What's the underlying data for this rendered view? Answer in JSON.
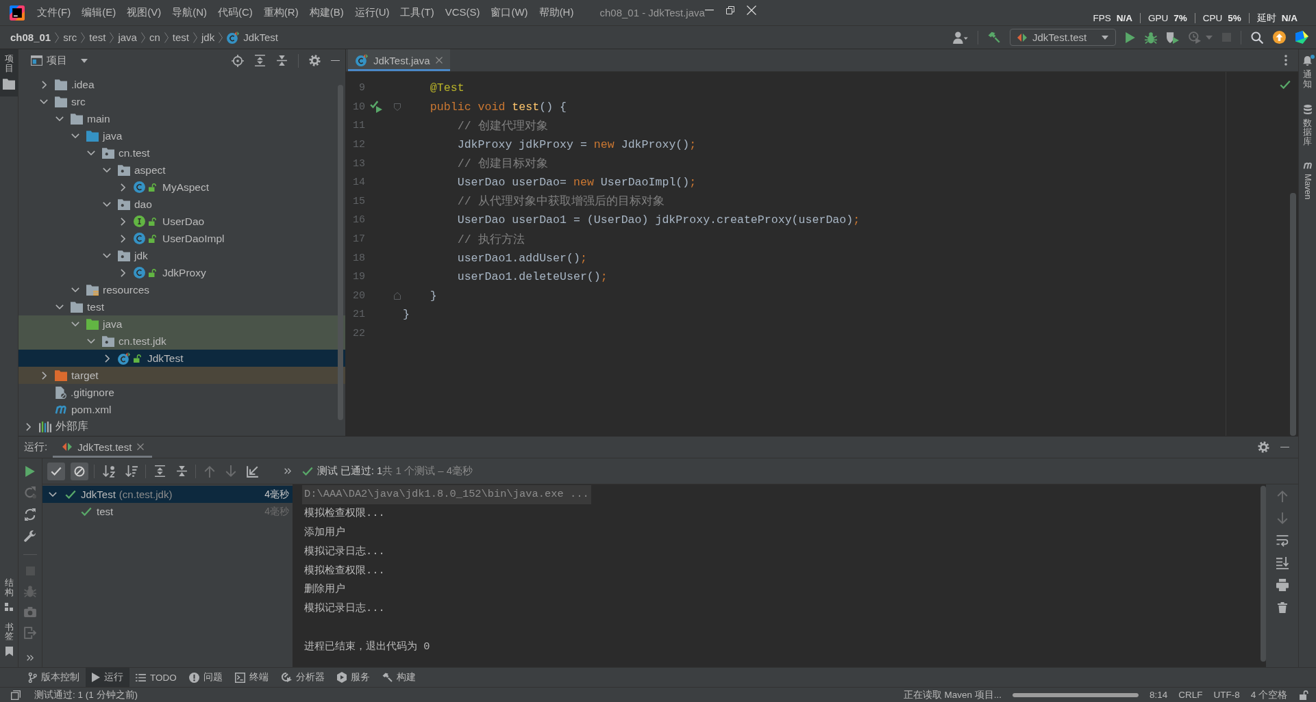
{
  "menu_bar": {
    "items": [
      "文件(F)",
      "编辑(E)",
      "视图(V)",
      "导航(N)",
      "代码(C)",
      "重构(R)",
      "构建(B)",
      "运行(U)",
      "工具(T)",
      "VCS(S)",
      "窗口(W)",
      "帮助(H)"
    ],
    "window_title": "ch08_01 - JdkTest.java"
  },
  "perf_overlay": [
    {
      "label": "FPS",
      "value": "N/A"
    },
    {
      "label": "GPU",
      "value": "7%"
    },
    {
      "label": "CPU",
      "value": "5%"
    },
    {
      "label": "延时",
      "value": "N/A"
    }
  ],
  "breadcrumbs": [
    {
      "label": "ch08_01",
      "kind": "project"
    },
    {
      "label": "src",
      "kind": "folder"
    },
    {
      "label": "test",
      "kind": "folder"
    },
    {
      "label": "java",
      "kind": "folder"
    },
    {
      "label": "cn",
      "kind": "folder"
    },
    {
      "label": "test",
      "kind": "folder"
    },
    {
      "label": "jdk",
      "kind": "folder"
    },
    {
      "label": "JdkTest",
      "kind": "test_class"
    }
  ],
  "main_toolbar": {
    "run_config": "JdkTest.test",
    "buttons": [
      {
        "kind": "run",
        "disabled": false
      },
      {
        "kind": "debug",
        "disabled": false
      },
      {
        "kind": "coverage",
        "disabled": false
      },
      {
        "kind": "profile",
        "disabled": true
      },
      {
        "kind": "stop",
        "disabled": true
      }
    ]
  },
  "left_strip": {
    "top": [
      {
        "label": "项目",
        "kind": "project",
        "selected": true
      }
    ],
    "bottom": [
      {
        "label": "结构",
        "kind": "structure",
        "selected": false
      },
      {
        "label": "书签",
        "kind": "bookmarks",
        "selected": false
      }
    ]
  },
  "right_strip": [
    {
      "label": "通知",
      "kind": "notifications",
      "unread": true
    },
    {
      "label": "数据库",
      "kind": "database",
      "unread": false
    },
    {
      "label": "Maven",
      "kind": "maven",
      "unread": false
    }
  ],
  "project_panel": {
    "title": "项目",
    "tree": [
      {
        "children": [
          {
            "label": ".idea",
            "kind": "folder",
            "expanded": false,
            "selected": false
          },
          {
            "label": "src",
            "kind": "folder",
            "expanded": true,
            "selected": false,
            "children": [
              {
                "label": "main",
                "kind": "folder",
                "expanded": true,
                "selected": false,
                "children": [
                  {
                    "label": "java",
                    "kind": "source_root",
                    "expanded": true,
                    "selected": false,
                    "children": [
                      {
                        "label": "cn.test",
                        "kind": "package",
                        "expanded": true,
                        "selected": false,
                        "children": [
                          {
                            "label": "aspect",
                            "kind": "package",
                            "expanded": true,
                            "selected": false,
                            "children": [
                              {
                                "label": "MyAspect",
                                "kind": "class",
                                "expanded": false,
                                "selected": false
                              }
                            ]
                          },
                          {
                            "label": "dao",
                            "kind": "package",
                            "expanded": true,
                            "selected": false,
                            "children": [
                              {
                                "label": "UserDao",
                                "kind": "interface",
                                "expanded": false,
                                "selected": false
                              },
                              {
                                "label": "UserDaoImpl",
                                "kind": "class",
                                "expanded": false,
                                "selected": false
                              }
                            ]
                          },
                          {
                            "label": "jdk",
                            "kind": "package",
                            "expanded": true,
                            "selected": false,
                            "children": [
                              {
                                "label": "JdkProxy",
                                "kind": "class",
                                "expanded": false,
                                "selected": false
                              }
                            ]
                          }
                        ]
                      }
                    ]
                  },
                  {
                    "label": "resources",
                    "kind": "resources_root",
                    "expanded": true,
                    "selected": false
                  }
                ]
              },
              {
                "label": "test",
                "kind": "folder",
                "expanded": true,
                "selected": false,
                "children": [
                  {
                    "label": "java",
                    "kind": "test_root",
                    "expanded": true,
                    "selected": false,
                    "color": "#4a5449",
                    "children": [
                      {
                        "label": "cn.test.jdk",
                        "kind": "package",
                        "expanded": true,
                        "selected": false,
                        "color": "#4a5449",
                        "children": [
                          {
                            "label": "JdkTest",
                            "kind": "test_class",
                            "expanded": false,
                            "selected": true
                          }
                        ]
                      }
                    ]
                  }
                ]
              }
            ]
          },
          {
            "label": "target",
            "kind": "excluded_folder",
            "expanded": false,
            "selected": false,
            "color": "#4b463a"
          },
          {
            "label": ".gitignore",
            "kind": "ignore_file",
            "selected": false
          },
          {
            "label": "pom.xml",
            "kind": "maven_file",
            "selected": false
          }
        ]
      },
      {
        "label": "外部库",
        "kind": "library",
        "expanded": false,
        "selected": false
      }
    ]
  },
  "editor": {
    "tabs": [
      {
        "label": "JdkTest.java",
        "kind": "test_class",
        "selected": true
      }
    ],
    "lines": [
      {
        "number": "9",
        "tokens": [
          {
            "text": "    @Test",
            "kind": "annotation"
          }
        ]
      },
      {
        "number": "10",
        "gutter_marks": [
          {
            "kind": "run_test"
          },
          {
            "kind": "fold_start"
          }
        ],
        "tokens": [
          {
            "text": "    public void ",
            "kind": "keyword"
          },
          {
            "text": "test",
            "kind": "method"
          },
          {
            "text": "() {",
            "kind": "plain"
          }
        ]
      },
      {
        "number": "11",
        "tokens": [
          {
            "text": "        // 创建代理对象",
            "kind": "comment"
          }
        ]
      },
      {
        "number": "12",
        "tokens": [
          {
            "text": "        JdkProxy jdkProxy = ",
            "kind": "plain"
          },
          {
            "text": "new",
            "kind": "keyword"
          },
          {
            "text": " JdkProxy()",
            "kind": "plain"
          },
          {
            "text": ";",
            "kind": "keyword"
          }
        ]
      },
      {
        "number": "13",
        "tokens": [
          {
            "text": "        // 创建目标对象",
            "kind": "comment"
          }
        ]
      },
      {
        "number": "14",
        "tokens": [
          {
            "text": "        UserDao userDao= ",
            "kind": "plain"
          },
          {
            "text": "new",
            "kind": "keyword"
          },
          {
            "text": " UserDaoImpl()",
            "kind": "plain"
          },
          {
            "text": ";",
            "kind": "keyword"
          }
        ]
      },
      {
        "number": "15",
        "tokens": [
          {
            "text": "        // 从代理对象中获取增强后的目标对象",
            "kind": "comment"
          }
        ]
      },
      {
        "number": "16",
        "tokens": [
          {
            "text": "        UserDao userDao1 = (UserDao) jdkProxy.createProxy(userDao)",
            "kind": "plain"
          },
          {
            "text": ";",
            "kind": "keyword"
          }
        ]
      },
      {
        "number": "17",
        "tokens": [
          {
            "text": "        // 执行方法",
            "kind": "comment"
          }
        ]
      },
      {
        "number": "18",
        "tokens": [
          {
            "text": "        userDao1.addUser()",
            "kind": "plain"
          },
          {
            "text": ";",
            "kind": "keyword"
          }
        ]
      },
      {
        "number": "19",
        "tokens": [
          {
            "text": "        userDao1.deleteUser()",
            "kind": "plain"
          },
          {
            "text": ";",
            "kind": "keyword"
          }
        ]
      },
      {
        "number": "20",
        "gutter_marks": [
          {
            "kind": "fold_end"
          }
        ],
        "tokens": [
          {
            "text": "    }",
            "kind": "plain"
          }
        ]
      },
      {
        "number": "21",
        "tokens": [
          {
            "text": "}",
            "kind": "plain"
          }
        ]
      },
      {
        "number": "22"
      }
    ]
  },
  "run_panel": {
    "label": "运行:",
    "tabs": [
      {
        "label": "JdkTest.test",
        "kind": "test_run",
        "selected": true
      }
    ],
    "side_toolbar": [
      [
        {
          "kind": "rerun",
          "disabled": false
        },
        {
          "kind": "rerun_failed",
          "disabled": true
        },
        {
          "kind": "auto_test",
          "disabled": false
        },
        {
          "kind": "settings",
          "disabled": false
        }
      ],
      [
        {
          "kind": "stop",
          "disabled": true
        },
        {
          "kind": "debug",
          "disabled": true
        },
        {
          "kind": "screenshot",
          "disabled": true
        },
        {
          "kind": "exit",
          "disabled": true
        },
        {
          "kind": "more",
          "disabled": false
        }
      ]
    ],
    "test_toolbar": [
      [
        {
          "kind": "show_passed",
          "on": true
        },
        {
          "kind": "show_ignored",
          "on": true
        }
      ],
      [
        {
          "kind": "sort_alpha",
          "disabled": false
        },
        {
          "kind": "sort_duration",
          "disabled": false
        }
      ],
      [
        {
          "kind": "expand_all",
          "disabled": false
        },
        {
          "kind": "collapse_all",
          "disabled": false
        }
      ],
      [
        {
          "kind": "previous",
          "disabled": true
        },
        {
          "kind": "next",
          "disabled": true
        },
        {
          "kind": "export",
          "disabled": false
        },
        {
          "kind": "more",
          "disabled": false
        }
      ]
    ],
    "summary": {
      "passed": true,
      "status": "测试 已通过: 1",
      "detail": "共 1 个测试 – 4毫秒"
    },
    "test_tree": [
      {
        "label": "JdkTest",
        "package": "(cn.test.jdk)",
        "duration": "4毫秒",
        "passed": true,
        "expanded": true,
        "selected": true,
        "children": [
          {
            "label": "test",
            "duration": "4毫秒",
            "passed": true,
            "selected": false
          }
        ]
      }
    ],
    "console": [
      {
        "text": "D:\\AAA\\DA2\\java\\jdk1.8.0_152\\bin\\java.exe ...",
        "kind": "command"
      },
      {
        "text": "模拟检查权限...",
        "kind": "output"
      },
      {
        "text": "添加用户",
        "kind": "output"
      },
      {
        "text": "模拟记录日志...",
        "kind": "output"
      },
      {
        "text": "模拟检查权限...",
        "kind": "output"
      },
      {
        "text": "删除用户",
        "kind": "output"
      },
      {
        "text": "模拟记录日志...",
        "kind": "output"
      },
      {
        "text": "进程已结束，退出代码为 0",
        "kind": "exit"
      }
    ],
    "console_toolbar": [
      {
        "kind": "previous",
        "disabled": true
      },
      {
        "kind": "next",
        "disabled": true
      },
      {
        "kind": "soft_wrap",
        "disabled": false
      },
      {
        "kind": "scroll_to_end",
        "disabled": false
      },
      {
        "kind": "print",
        "disabled": false
      },
      {
        "kind": "clear",
        "disabled": false
      }
    ]
  },
  "tool_window_bar": [
    {
      "label": "版本控制",
      "kind": "vcs",
      "selected": false
    },
    {
      "label": "运行",
      "kind": "run",
      "selected": true
    },
    {
      "label": "TODO",
      "kind": "todo",
      "selected": false
    },
    {
      "label": "问题",
      "kind": "problems",
      "selected": false
    },
    {
      "label": "终端",
      "kind": "terminal",
      "selected": false
    },
    {
      "label": "分析器",
      "kind": "profiler",
      "selected": false
    },
    {
      "label": "服务",
      "kind": "services",
      "selected": false
    },
    {
      "label": "构建",
      "kind": "build",
      "selected": false
    }
  ],
  "status_bar": {
    "message": "测试通过: 1 (1 分钟之前)",
    "task": "正在读取 Maven 项目...",
    "progress": {
      "level": 1
    },
    "widgets": [
      "8:14",
      "CRLF",
      "UTF-8",
      "4 个空格"
    ]
  }
}
